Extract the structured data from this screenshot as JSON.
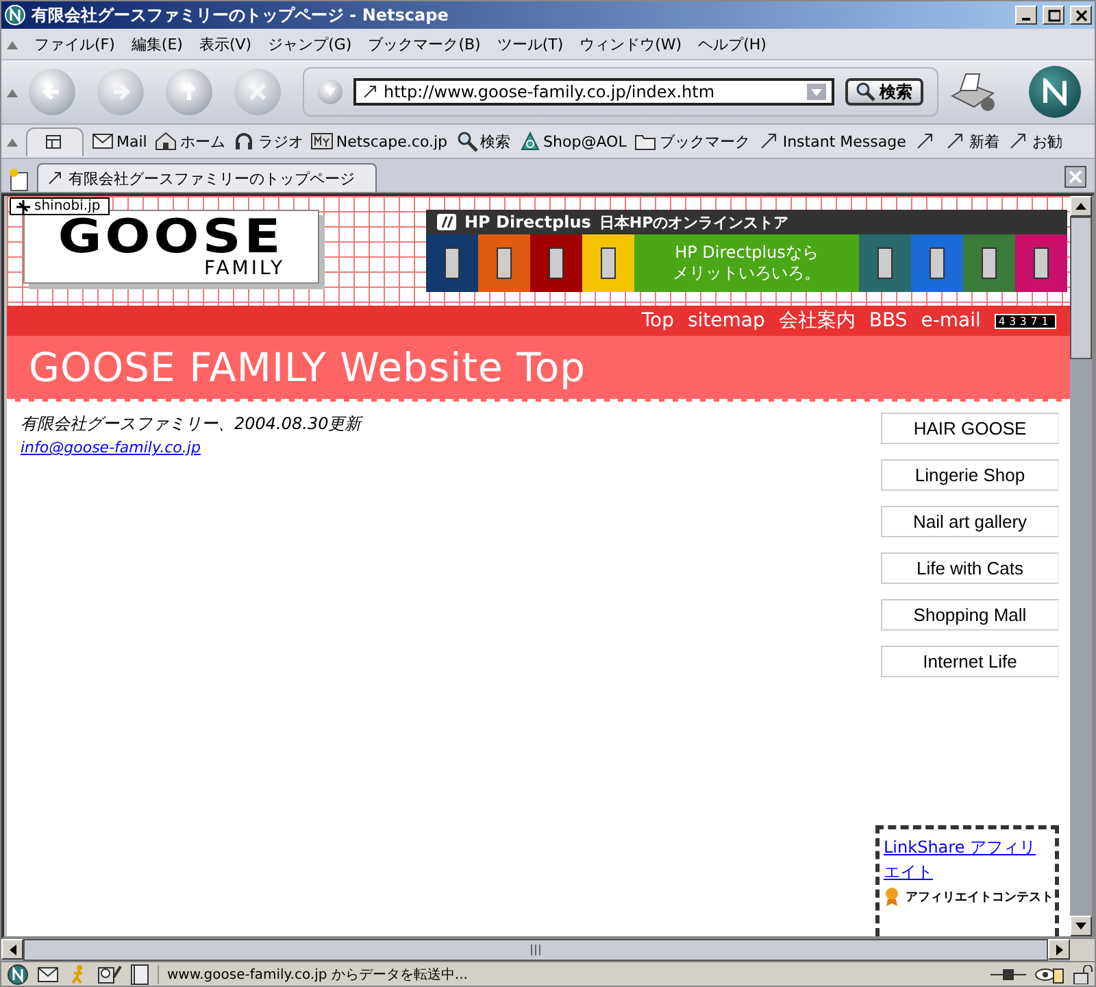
{
  "window": {
    "title": "有限会社グースファミリーのトップページ - Netscape"
  },
  "menu": [
    "ファイル(F)",
    "編集(E)",
    "表示(V)",
    "ジャンプ(G)",
    "ブックマーク(B)",
    "ツール(T)",
    "ウィンドウ(W)",
    "ヘルプ(H)"
  ],
  "navigation": {
    "url": "http://www.goose-family.co.jp/index.htm",
    "search_button": "検索"
  },
  "personal_toolbar": [
    {
      "kind": "mail",
      "label": "Mail"
    },
    {
      "kind": "home",
      "label": "ホーム"
    },
    {
      "kind": "radio",
      "label": "ラジオ"
    },
    {
      "kind": "my",
      "label": "Netscape.co.jp"
    },
    {
      "kind": "search",
      "label": "検索"
    },
    {
      "kind": "shop",
      "label": "Shop@AOL"
    },
    {
      "kind": "folder",
      "label": "ブックマーク"
    },
    {
      "kind": "bookmark",
      "label": "Instant Message"
    },
    {
      "kind": "bookmark"
    },
    {
      "kind": "bookmark",
      "label": "新着"
    },
    {
      "kind": "bookmark",
      "label": "お勧"
    }
  ],
  "tabs": [
    {
      "label": "有限会社グースファミリーのトップページ",
      "selected": true
    }
  ],
  "page": {
    "badge": "shinobi.jp",
    "logo": {
      "title": "GOOSE",
      "subtitle": "FAMILY"
    },
    "ad": {
      "brand": "HP Directplus",
      "tagline": "日本HPのオンラインストア",
      "message": [
        "HP Directplusなら",
        "メリットいろいろ。"
      ],
      "tiles_left": [
        {
          "color": "#123a6e"
        },
        {
          "color": "#e05a10"
        },
        {
          "color": "#a00000"
        },
        {
          "color": "#f5c400"
        }
      ],
      "tiles_right": [
        {
          "color": "#2a6a6a"
        },
        {
          "color": "#1a6ad8"
        },
        {
          "color": "#3a7a3a"
        },
        {
          "color": "#c8106a"
        }
      ]
    },
    "nav_links": [
      "Top",
      "sitemap",
      "会社案内",
      "BBS",
      "e-mail"
    ],
    "counter": "43371",
    "heading": "GOOSE FAMILY Website Top",
    "updated": "有限会社グースファミリー、2004.08.30更新",
    "email": "info@goose-family.co.jp",
    "side_links": [
      "HAIR GOOSE",
      "Lingerie Shop",
      "Nail art gallery",
      "Life with Cats",
      "Shopping Mall",
      "Internet Life"
    ],
    "affiliate": {
      "link": "LinkShare アフィリエイト",
      "banner": "アフィリエイトコンテスト"
    }
  },
  "status_bar": {
    "text": "www.goose-family.co.jp からデータを転送中..."
  }
}
